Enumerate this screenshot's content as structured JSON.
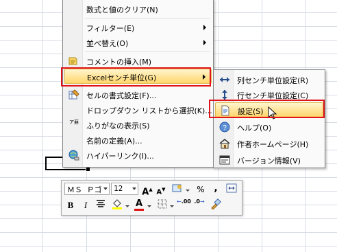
{
  "context_menu": {
    "items": [
      {
        "label": "数式と値のクリア(N)"
      },
      {
        "label": "フィルター(E)"
      },
      {
        "label": "並べ替え(O)"
      },
      {
        "label": "コメントの挿入(M)"
      },
      {
        "label": "Excelセンチ単位(G)"
      },
      {
        "label": "セルの書式設定(F)..."
      },
      {
        "label": "ドロップダウン リストから選択(K)..."
      },
      {
        "label": "ふりがなの表示(S)"
      },
      {
        "label": "名前の定義(A)..."
      },
      {
        "label": "ハイパーリンク(I)..."
      }
    ],
    "furigana_icon_text": "ア亜"
  },
  "submenu": {
    "items": [
      {
        "label": "列センチ単位設定(R)"
      },
      {
        "label": "行センチ単位設定(C)"
      },
      {
        "label": "設定(S)"
      },
      {
        "label": "ヘルプ(O)"
      },
      {
        "label": "作者ホームページ(H)"
      },
      {
        "label": "バージョン情報(V)"
      }
    ]
  },
  "mini_toolbar": {
    "font_name": "ＭＳ Ｐゴ",
    "font_size": "12",
    "grow_font": "A",
    "shrink_font": "A",
    "percent": "%",
    "comma": ",",
    "bold": "B",
    "italic": "I",
    "font_color_letter": "A",
    "increase_decimal": ".00",
    "decrease_decimal": ".0"
  },
  "colors": {
    "highlight": "#ffd66b",
    "callout_red": "#e0141a",
    "font_color": "#e01010",
    "fill_color": "#ffff00"
  }
}
